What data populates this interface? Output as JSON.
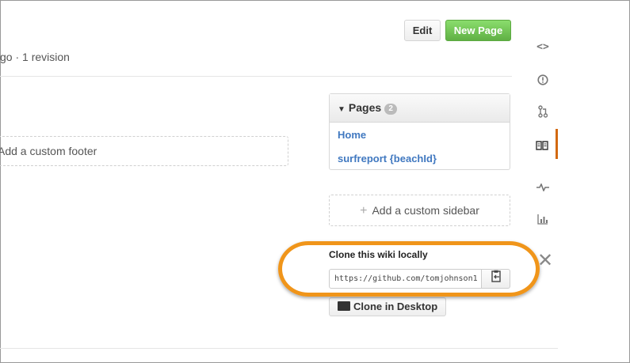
{
  "header": {
    "meta_text": "go · 1 revision",
    "edit_label": "Edit",
    "new_page_label": "New Page"
  },
  "main": {
    "custom_footer_label": "Add a custom footer"
  },
  "pages": {
    "title": "Pages",
    "count": "2",
    "items": [
      {
        "label": "Home"
      },
      {
        "label": "surfreport {beachId}"
      }
    ]
  },
  "sidebar_placeholder": {
    "plus": "+",
    "label": "Add a custom sidebar"
  },
  "clone": {
    "label": "Clone this wiki locally",
    "url": "https://github.com/tomjohnson1",
    "desktop_label": "Clone in Desktop"
  },
  "repo_nav": {
    "items": [
      {
        "icon": "code-icon",
        "glyph": "<>"
      },
      {
        "icon": "issues-icon",
        "glyph": "ⓘ"
      },
      {
        "icon": "pull-request-icon",
        "glyph": "⑂"
      },
      {
        "icon": "wiki-book-icon",
        "glyph": "📖"
      },
      {
        "icon": "pulse-icon",
        "glyph": "∿"
      },
      {
        "icon": "graphs-icon",
        "glyph": "▥"
      }
    ]
  },
  "colors": {
    "new_page_green": "#6cc644",
    "link_blue": "#4078c0",
    "highlight_orange": "#f0951a",
    "active_nav_orange": "#d26911"
  }
}
